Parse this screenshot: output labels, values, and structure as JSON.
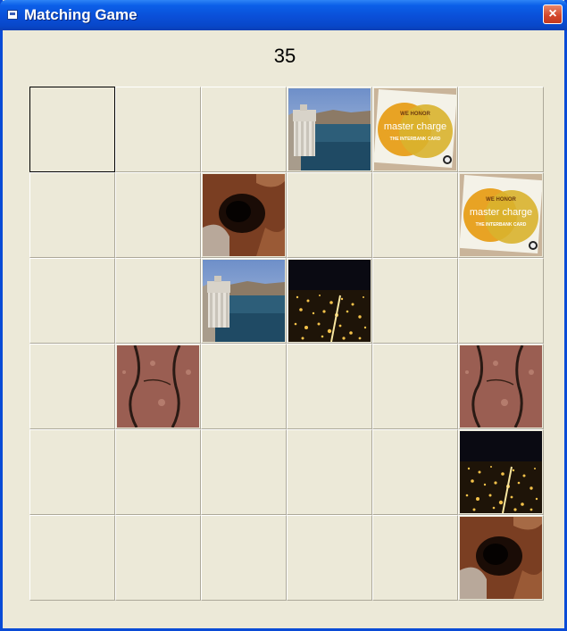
{
  "window": {
    "title": "Matching Game",
    "close_label": "×"
  },
  "game": {
    "score": "35",
    "rows": 6,
    "cols": 6,
    "selected": [
      0,
      0
    ],
    "tiles": [
      [
        "hidden",
        "hidden",
        "hidden",
        "dam",
        "master-charge",
        "hidden"
      ],
      [
        "hidden",
        "hidden",
        "cave",
        "hidden",
        "hidden",
        "master-charge"
      ],
      [
        "hidden",
        "hidden",
        "dam",
        "city-night",
        "hidden",
        "hidden"
      ],
      [
        "hidden",
        "rock",
        "hidden",
        "hidden",
        "hidden",
        "rock"
      ],
      [
        "hidden",
        "hidden",
        "hidden",
        "hidden",
        "hidden",
        "city-night"
      ],
      [
        "hidden",
        "hidden",
        "hidden",
        "hidden",
        "hidden",
        "cave"
      ]
    ],
    "card_text": {
      "line1": "WE HONOR",
      "line2": "master charge",
      "line3": "THE INTERBANK CARD"
    }
  },
  "colors": {
    "title_bar": "#0A4FD8",
    "face": "#ECE9D8"
  }
}
